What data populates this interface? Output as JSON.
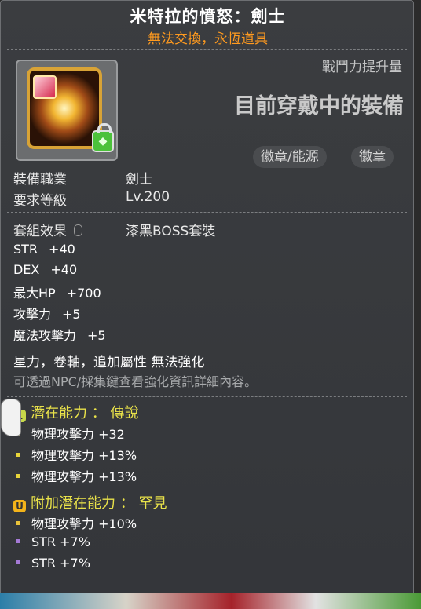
{
  "header": {
    "title": "米特拉的憤怒：劍士",
    "subtitle": "無法交換，永恆道具"
  },
  "power": {
    "label": "戰鬥力提升量",
    "value": "目前穿戴中的裝備"
  },
  "tags": [
    "徽章/能源",
    "徽章"
  ],
  "info": [
    {
      "label": "裝備職業",
      "value": "劍士"
    },
    {
      "label": "要求等級",
      "value": "Lv.200"
    }
  ],
  "set": {
    "label": "套組效果",
    "value": "漆黑BOSS套裝"
  },
  "stats": [
    {
      "name": "STR",
      "value": "+40"
    },
    {
      "name": "DEX",
      "value": "+40"
    },
    {
      "name": "最大HP",
      "value": "+700"
    },
    {
      "name": "攻擊力",
      "value": "+5"
    },
    {
      "name": "魔法攻擊力",
      "value": "+5"
    }
  ],
  "restrictions": "星力，卷軸，追加屬性 無法強化",
  "hint": "可透過NPC/採集鍵查看強化資訊詳細內容。",
  "potential": {
    "badge": "L",
    "label": "潛在能力 ： 傳說",
    "lines": [
      {
        "text": "物理攻擊力 +32",
        "color": "#e8d53a"
      },
      {
        "text": "物理攻擊力 +13%",
        "color": "#e8d53a"
      },
      {
        "text": "物理攻擊力 +13%",
        "color": "#e8d53a"
      }
    ]
  },
  "additional": {
    "badge": "U",
    "label": "附加潛在能力 ： 罕見",
    "lines": [
      {
        "text": "物理攻擊力 +10%",
        "color": "#e8c23a"
      },
      {
        "text": "STR +7%",
        "color": "#a57ad6"
      },
      {
        "text": "STR +7%",
        "color": "#a57ad6"
      }
    ]
  },
  "colors": {
    "subtitle": "#ff9a1f",
    "section_head": "#e9e24a",
    "legend_badge": "#c6d84a",
    "unique_badge": "#f3b31a"
  },
  "icons": {
    "item": "emblem-icon",
    "lock": "lock-icon",
    "set_icon": "mouse-icon",
    "cursor": "hand-cursor-icon"
  }
}
